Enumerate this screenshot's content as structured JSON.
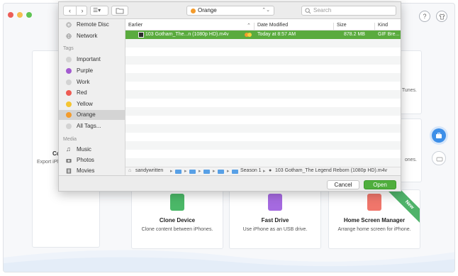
{
  "dialog": {
    "location": "Orange",
    "search_placeholder": "Search",
    "columns": {
      "name": "Earlier",
      "date": "Date Modified",
      "size": "Size",
      "kind": "Kind"
    },
    "file": {
      "name": "103 Gotham_The...n (1080p HD).m4v",
      "date": "Today at 8:57 AM",
      "size": "878.2 MB",
      "kind": "GIF Bre..."
    },
    "sidebar": {
      "devices": [
        {
          "label": "Remote Disc",
          "icon": "disc-icon"
        },
        {
          "label": "Network",
          "icon": "globe-icon"
        }
      ],
      "tags_header": "Tags",
      "tags": [
        {
          "label": "Important",
          "color": "#d3d3d3"
        },
        {
          "label": "Purple",
          "color": "#a35bd0"
        },
        {
          "label": "Work",
          "color": "#d3d3d3"
        },
        {
          "label": "Red",
          "color": "#ee5b53"
        },
        {
          "label": "Yellow",
          "color": "#f5c531"
        },
        {
          "label": "Orange",
          "color": "#f39b2c"
        },
        {
          "label": "All Tags...",
          "color": "#d3d3d3"
        }
      ],
      "media_header": "Media",
      "media": [
        {
          "label": "Music",
          "icon": "music-icon"
        },
        {
          "label": "Photos",
          "icon": "camera-icon"
        },
        {
          "label": "Movies",
          "icon": "film-icon"
        }
      ]
    },
    "path": {
      "user": "sandywritten",
      "folder": "Season 1",
      "file": "103 Gotham_The Legend Reborn (1080p HD).m4v"
    },
    "cancel_label": "Cancel",
    "open_label": "Open"
  },
  "background": {
    "left_card": {
      "title": "Co",
      "desc": "Export iPh"
    },
    "right_card_top_text": "Tunes.",
    "right_card_mid_text": "ones.",
    "features": [
      {
        "title": "Clone Device",
        "desc": "Clone content between iPhones.",
        "color": "#4bb868"
      },
      {
        "title": "Fast Drive",
        "desc": "Use iPhone as an USB drive.",
        "color": "#a56ae0"
      },
      {
        "title": "Home Screen Manager",
        "desc": "Arrange home screen for iPhone.",
        "color": "#f0766b"
      }
    ],
    "new_badge": "New"
  },
  "colors": {
    "accent_green": "#5aab3e",
    "accent_blue": "#3d8fe8"
  }
}
